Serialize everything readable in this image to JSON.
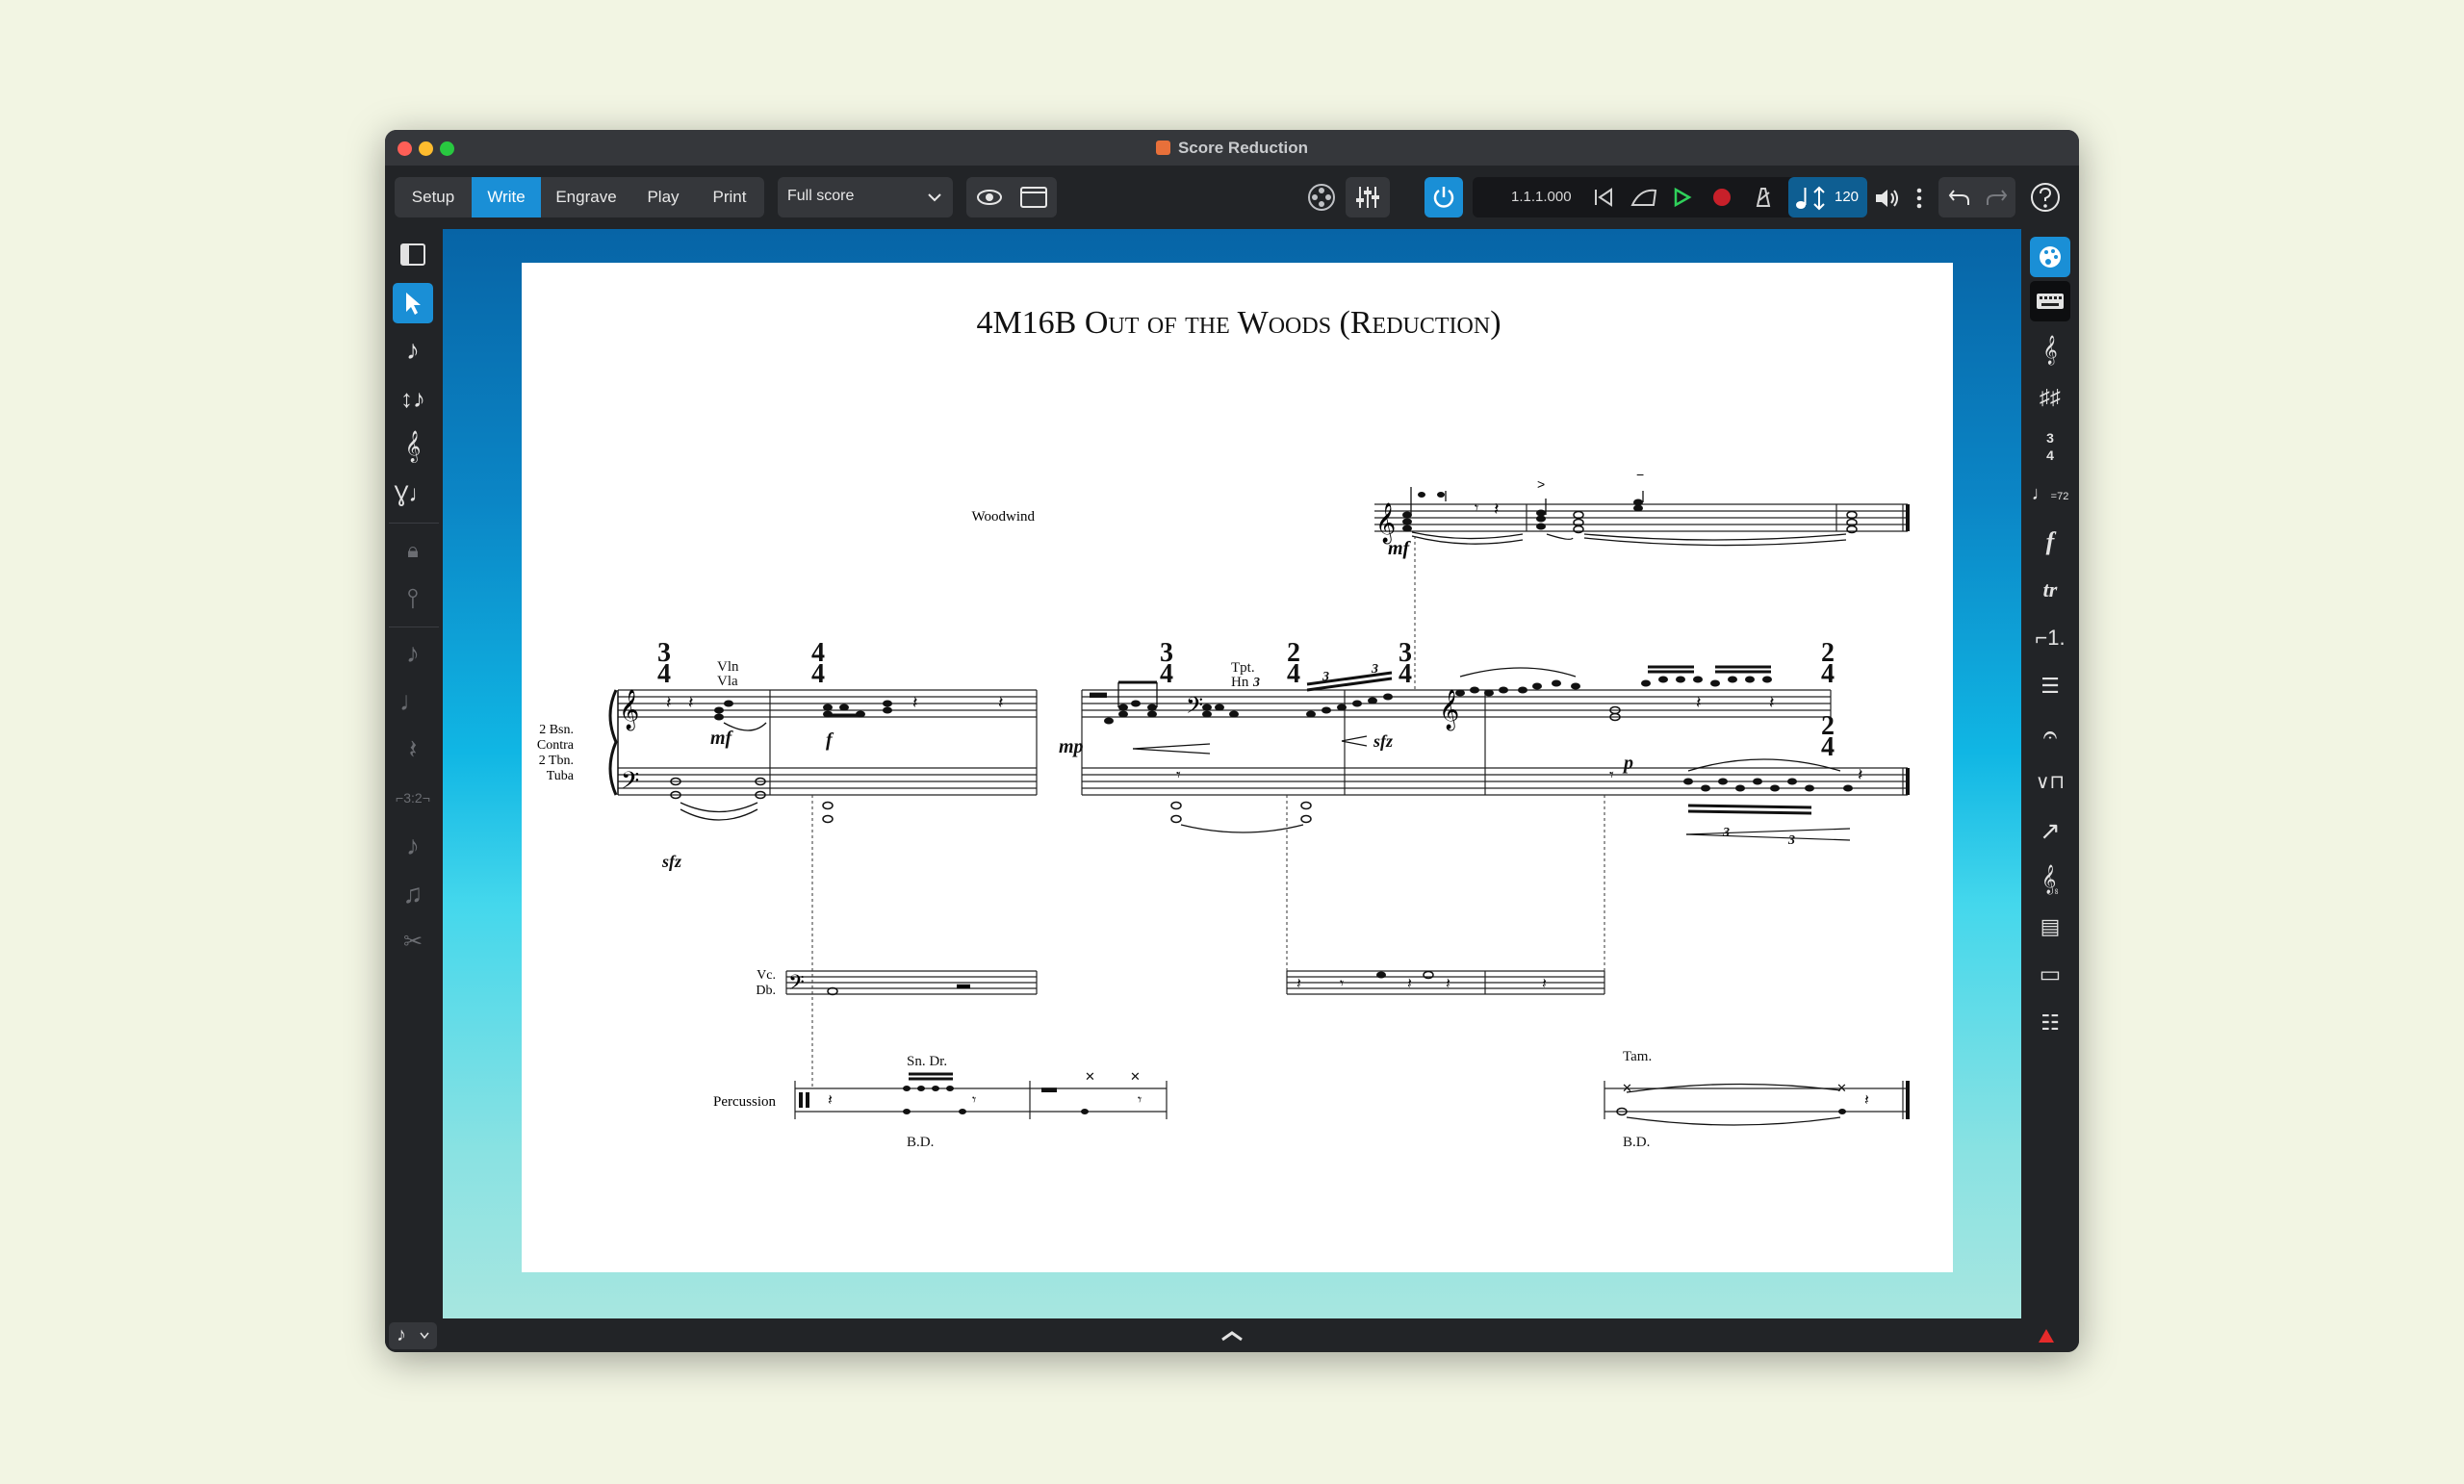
{
  "window": {
    "title": "Score Reduction"
  },
  "modes": [
    {
      "label": "Setup",
      "active": false
    },
    {
      "label": "Write",
      "active": true
    },
    {
      "label": "Engrave",
      "active": false
    },
    {
      "label": "Play",
      "active": false
    },
    {
      "label": "Print",
      "active": false
    }
  ],
  "layout_select": {
    "value": "Full score"
  },
  "transport": {
    "position": "1.1.1.000",
    "tempo": "120"
  },
  "icons": {
    "galley_view": "eye-icon",
    "page_view": "page-view-icon",
    "video": "film-reel-icon",
    "mixer": "mixer-icon",
    "activate": "power-icon",
    "rewind": "rewind-icon",
    "click": "metronome-click-icon",
    "play": "play-icon",
    "record": "record-icon",
    "metronome": "metronome-icon",
    "volume": "speaker-icon",
    "more": "more-vertical-icon",
    "undo": "undo-icon",
    "redo": "redo-icon",
    "help": "help-icon"
  },
  "left_tools": [
    "panel-toggle-icon",
    "select-icon",
    "note-input-icon",
    "insert-mode-icon",
    "chord-input-icon",
    "voice-icon",
    "lock-duration-icon",
    "force-pitch-icon",
    "rest-input-icon",
    "slur-icon",
    "dotted-note-icon",
    "rest-icon",
    "tuplet-icon",
    "grace-note-icon",
    "tie-icon",
    "scissors-icon"
  ],
  "right_tools": [
    "palette-icon",
    "keyboard-icon",
    "clef-icon",
    "key-signature-icon",
    "time-signature-icon",
    "tempo-icon",
    "dynamics-icon",
    "ornaments-icon",
    "repeat-icon",
    "bars-icon",
    "holds-icon",
    "playing-techniques-icon",
    "lines-icon",
    "playing-hints-icon",
    "cues-icon",
    "comments-icon",
    "properties-list-icon"
  ],
  "score": {
    "title": "4M16B Out of the Woods (Reduction)",
    "staff_labels": {
      "woodwind": "Woodwind",
      "low_brass_1": "2 Bsn.",
      "low_brass_2": "Contra",
      "low_brass_3": "2 Tbn.",
      "low_brass_4": "Tuba",
      "vcdb_1": "Vc.",
      "vcdb_2": "Db.",
      "percussion": "Percussion"
    },
    "annotations": {
      "vln": "Vln",
      "vla": "Vla",
      "tpt": "Tpt.",
      "hn": "Hn",
      "sn_dr": "Sn. Dr.",
      "bd1": "B.D.",
      "tam": "Tam.",
      "bd2": "B.D."
    },
    "dynamics": {
      "ww_mf": "mf",
      "mf": "mf",
      "f": "f",
      "mp": "mp",
      "sfz1": "sfz",
      "sfz2": "sfz",
      "p": "p"
    },
    "tuplets": {
      "t1": "3",
      "t2": "3",
      "t3": "3",
      "t4": "3",
      "t5": "3"
    },
    "time_signatures": {
      "ts1": {
        "num": "3",
        "den": "4"
      },
      "ts2": {
        "num": "4",
        "den": "4"
      },
      "ts3": {
        "num": "3",
        "den": "4"
      },
      "ts4": {
        "num": "2",
        "den": "4"
      },
      "ts5": {
        "num": "3",
        "den": "4"
      },
      "ts6": {
        "num": "2",
        "den": "4"
      },
      "ts7": {
        "num": "2",
        "den": "4"
      }
    }
  },
  "colors": {
    "accent": "#1a8fd6",
    "toolbar": "#222427",
    "page": "#ffffff"
  }
}
